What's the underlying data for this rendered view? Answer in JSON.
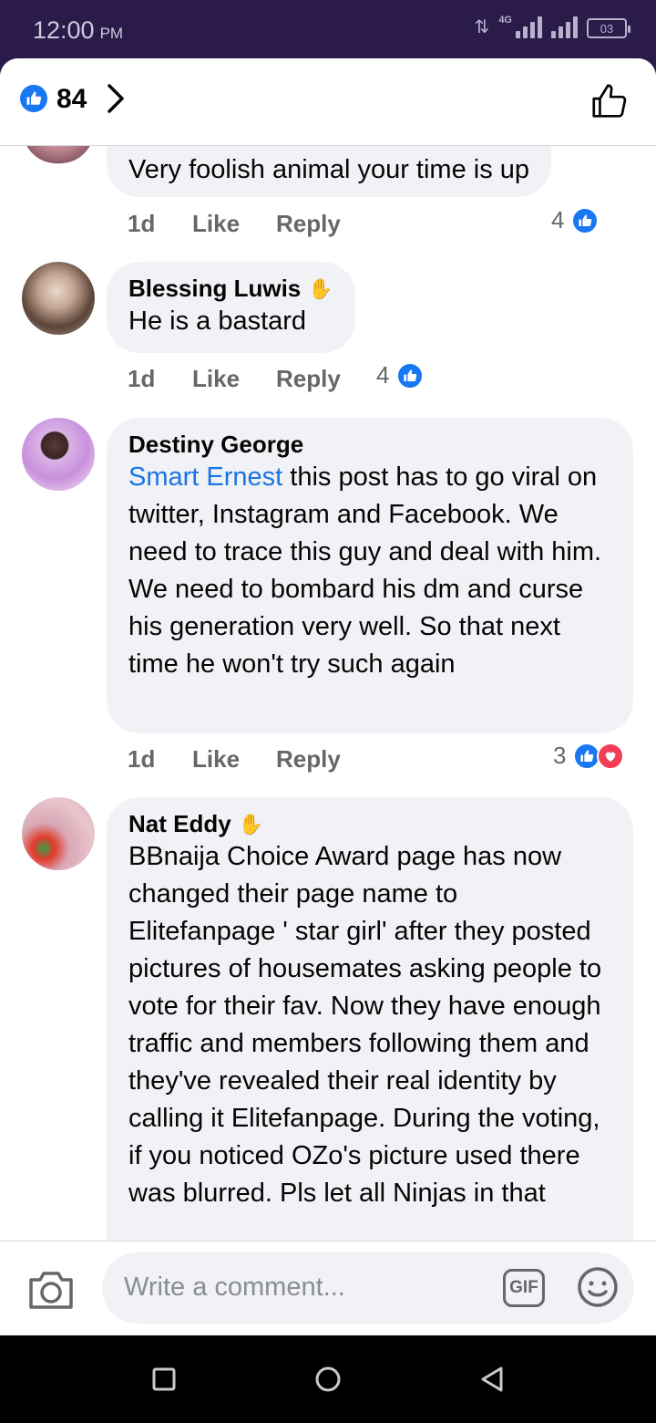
{
  "status_bar": {
    "time": "12:00",
    "ampm": "PM",
    "network": "4G",
    "battery": "03"
  },
  "header": {
    "like_count": "84"
  },
  "comments": [
    {
      "name": "",
      "text": "Very foolish animal your time is up",
      "time": "1d",
      "like_label": "Like",
      "reply_label": "Reply",
      "reaction_count": "4"
    },
    {
      "name": "Blessing Luwis",
      "text": "He is a bastard",
      "time": "1d",
      "like_label": "Like",
      "reply_label": "Reply",
      "reaction_count": "4"
    },
    {
      "name": "Destiny George",
      "mention": "Smart Ernest",
      "text": " this post has to go viral on twitter, Instagram and Facebook. We need to trace this guy and deal with him. We need to bombard his dm and curse his generation very well. So that next time he won't try such again",
      "time": "1d",
      "like_label": "Like",
      "reply_label": "Reply",
      "reaction_count": "3"
    },
    {
      "name": "Nat Eddy",
      "text": "BBnaija Choice Award page has now changed their page name to Elitefanpage ' star girl' after they posted pictures of housemates asking people to vote for their fav. Now they have enough traffic and members following them and they've revealed their real identity by calling it Elitefanpage. During the voting, if you noticed OZo's picture used there was blurred. Pls let all Ninjas in that"
    }
  ],
  "composer": {
    "placeholder": "Write a comment...",
    "gif_label": "GIF"
  },
  "colors": {
    "brand_blue": "#1877f2",
    "love_red": "#f33e58",
    "status_bar_bg": "#2b1b4a"
  }
}
